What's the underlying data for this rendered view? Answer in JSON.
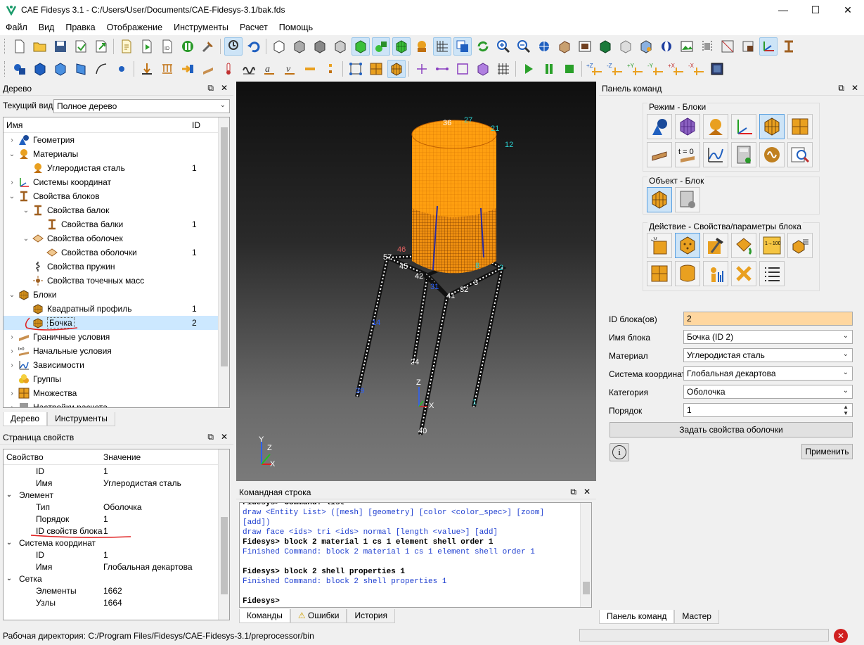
{
  "window": {
    "title": "CAE Fidesys 3.1 - C:/Users/User/Documents/CAE-Fidesys-3.1/bak.fds",
    "minimize": "—",
    "maximize": "☐",
    "close": "✕"
  },
  "menu": [
    "Файл",
    "Вид",
    "Правка",
    "Отображение",
    "Инструменты",
    "Расчет",
    "Помощь"
  ],
  "tree_panel": {
    "title": "Дерево",
    "current_view_label": "Текущий вид",
    "current_view_value": "Полное дерево",
    "col_name": "Имя",
    "col_id": "ID",
    "rows": [
      {
        "label": "Геометрия",
        "id": "",
        "indent": 0,
        "exp": "›",
        "icon": "geometry-icon"
      },
      {
        "label": "Материалы",
        "id": "",
        "indent": 0,
        "exp": "⌄",
        "icon": "materials-icon"
      },
      {
        "label": "Углеродистая сталь",
        "id": "1",
        "indent": 1,
        "exp": "",
        "icon": "material-icon"
      },
      {
        "label": "Системы координат",
        "id": "",
        "indent": 0,
        "exp": "›",
        "icon": "coord-system-icon"
      },
      {
        "label": "Свойства блоков",
        "id": "",
        "indent": 0,
        "exp": "⌄",
        "icon": "block-props-icon"
      },
      {
        "label": "Свойства балок",
        "id": "",
        "indent": 1,
        "exp": "⌄",
        "icon": "beam-props-icon"
      },
      {
        "label": "Свойства балки",
        "id": "1",
        "indent": 2,
        "exp": "",
        "icon": "beam-prop-icon"
      },
      {
        "label": "Свойства оболочек",
        "id": "",
        "indent": 1,
        "exp": "⌄",
        "icon": "shell-props-icon"
      },
      {
        "label": "Свойства оболочки",
        "id": "1",
        "indent": 2,
        "exp": "",
        "icon": "shell-prop-icon"
      },
      {
        "label": "Свойства пружин",
        "id": "",
        "indent": 1,
        "exp": "",
        "icon": "spring-props-icon"
      },
      {
        "label": "Свойства точечных масс",
        "id": "",
        "indent": 1,
        "exp": "",
        "icon": "point-mass-icon"
      },
      {
        "label": "Блоки",
        "id": "",
        "indent": 0,
        "exp": "⌄",
        "icon": "blocks-icon"
      },
      {
        "label": "Квадратный профиль",
        "id": "1",
        "indent": 1,
        "exp": "",
        "icon": "block-icon"
      },
      {
        "label": "Бочка",
        "id": "2",
        "indent": 1,
        "exp": "",
        "icon": "block-icon",
        "selected": true
      },
      {
        "label": "Граничные условия",
        "id": "",
        "indent": 0,
        "exp": "›",
        "icon": "boundary-icon"
      },
      {
        "label": "Начальные условия",
        "id": "",
        "indent": 0,
        "exp": "›",
        "icon": "initial-cond-icon"
      },
      {
        "label": "Зависимости",
        "id": "",
        "indent": 0,
        "exp": "›",
        "icon": "dependency-icon"
      },
      {
        "label": "Группы",
        "id": "",
        "indent": 0,
        "exp": "",
        "icon": "groups-icon"
      },
      {
        "label": "Множества",
        "id": "",
        "indent": 0,
        "exp": "›",
        "icon": "sets-icon"
      },
      {
        "label": "Настройки расчета",
        "id": "",
        "indent": 0,
        "exp": "›",
        "icon": "settings-icon"
      }
    ],
    "tabs": [
      "Дерево",
      "Инструменты"
    ]
  },
  "props_panel": {
    "title": "Страница свойств",
    "col_prop": "Свойство",
    "col_value": "Значение",
    "rows": [
      {
        "label": "ID",
        "value": "1",
        "indent": 1,
        "exp": ""
      },
      {
        "label": "Имя",
        "value": "Углеродистая сталь",
        "indent": 1,
        "exp": ""
      },
      {
        "label": "Элемент",
        "value": "",
        "indent": 0,
        "exp": "⌄"
      },
      {
        "label": "Тип",
        "value": "Оболочка",
        "indent": 1,
        "exp": ""
      },
      {
        "label": "Порядок",
        "value": "1",
        "indent": 1,
        "exp": ""
      },
      {
        "label": "ID свойств блока",
        "value": "1",
        "indent": 1,
        "exp": ""
      },
      {
        "label": "Система координат",
        "value": "",
        "indent": 0,
        "exp": "⌄"
      },
      {
        "label": "ID",
        "value": "1",
        "indent": 1,
        "exp": ""
      },
      {
        "label": "Имя",
        "value": "Глобальная декартова",
        "indent": 1,
        "exp": ""
      },
      {
        "label": "Сетка",
        "value": "",
        "indent": 0,
        "exp": "⌄"
      },
      {
        "label": "Элементы",
        "value": "1662",
        "indent": 1,
        "exp": ""
      },
      {
        "label": "Узлы",
        "value": "1664",
        "indent": 1,
        "exp": ""
      }
    ]
  },
  "viewport": {
    "labels": [
      "36",
      "27",
      "21",
      "12",
      "57",
      "46",
      "45",
      "42",
      "31",
      "41",
      "32",
      "3",
      "2",
      "8",
      "14",
      "24",
      "39",
      "40",
      "Z",
      "X",
      "Y",
      "Z",
      "X",
      "1"
    ],
    "accent": "#ffa21f"
  },
  "cmdline": {
    "title": "Командная строка",
    "lines": [
      {
        "text": "Fidesys> Command: list",
        "cls": "blk"
      },
      {
        "text": "draw <Entity List> ([mesh] [geometry] [color <color_spec>] [zoom]",
        "cls": "blue"
      },
      {
        "text": "[add])",
        "cls": "blue"
      },
      {
        "text": "draw face <ids> tri <ids> normal [length <value>] [add]",
        "cls": "blue"
      },
      {
        "text": "Fidesys> block 2 material 1 cs 1 element shell order 1",
        "cls": "blk"
      },
      {
        "text": "Finished Command: block 2 material 1 cs 1 element shell order 1",
        "cls": "blue"
      },
      {
        "text": " ",
        "cls": "blk"
      },
      {
        "text": "Fidesys> block 2 shell properties 1",
        "cls": "blk"
      },
      {
        "text": "Finished Command: block 2 shell properties 1",
        "cls": "blue"
      },
      {
        "text": " ",
        "cls": "blk"
      },
      {
        "text": "Fidesys>",
        "cls": "blk"
      }
    ],
    "tabs": [
      "Команды",
      "Ошибки",
      "История"
    ]
  },
  "cmd_panel": {
    "title": "Панель команд",
    "mode_group": "Режим - Блоки",
    "object_group": "Объект - Блок",
    "action_group": "Действие - Свойства/параметры блока",
    "fields": {
      "block_ids_label": "ID блока(ов)",
      "block_ids_value": "2",
      "block_name_label": "Имя блока",
      "block_name_value": "Бочка (ID 2)",
      "material_label": "Материал",
      "material_value": "Углеродистая сталь",
      "cs_label": "Система координат",
      "cs_value": "Глобальная декартова",
      "category_label": "Категория",
      "category_value": "Оболочка",
      "order_label": "Порядок",
      "order_value": "1"
    },
    "set_shell_button": "Задать свойства оболочки",
    "apply_button": "Применить",
    "info_button": "i",
    "tabs": [
      "Панель команд",
      "Мастер"
    ],
    "tz_label": "t = 0",
    "ratio_label": "1→100"
  },
  "status": {
    "workdir": "Рабочая директория: C:/Program Files/Fidesys/CAE-Fidesys-3.1/preprocessor/bin"
  },
  "colors": {
    "selection": "#cce8ff",
    "field_highlight": "#ffd7a0",
    "annotation": "#e02020"
  }
}
